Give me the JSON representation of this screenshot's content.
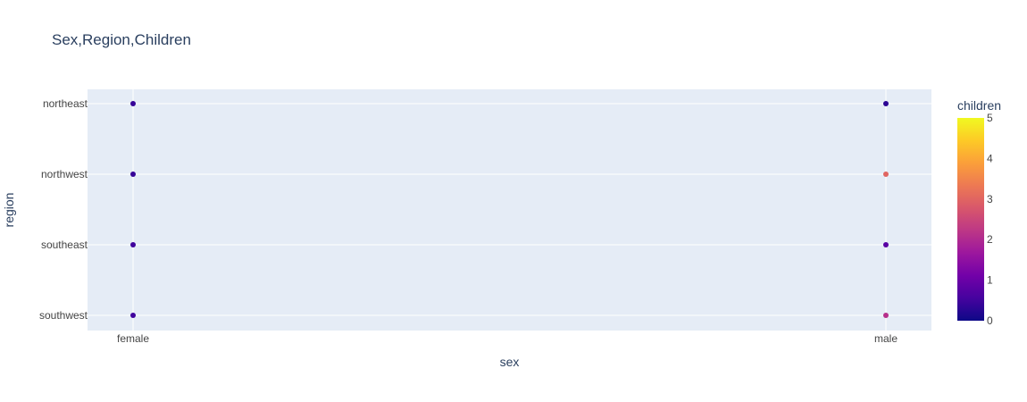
{
  "chart_data": {
    "type": "scatter",
    "title": "Sex,Region,Children",
    "xlabel": "sex",
    "ylabel": "region",
    "x_categories": [
      "female",
      "male"
    ],
    "y_categories": [
      "southwest",
      "southeast",
      "northwest",
      "northeast"
    ],
    "points": [
      {
        "x": "female",
        "y": "northeast",
        "children": 0.4
      },
      {
        "x": "male",
        "y": "northeast",
        "children": 0.3
      },
      {
        "x": "female",
        "y": "northwest",
        "children": 0.4
      },
      {
        "x": "male",
        "y": "northwest",
        "children": 3.0
      },
      {
        "x": "female",
        "y": "southeast",
        "children": 0.5
      },
      {
        "x": "male",
        "y": "southeast",
        "children": 0.8
      },
      {
        "x": "female",
        "y": "southwest",
        "children": 0.5
      },
      {
        "x": "male",
        "y": "southwest",
        "children": 2.1
      }
    ],
    "colorbar": {
      "title": "children",
      "min": 0,
      "max": 5,
      "ticks": [
        0,
        1,
        2,
        3,
        4,
        5
      ]
    },
    "grid": true,
    "colors": {
      "plot_bg": "#e5ecf6",
      "grid": "#ffffff",
      "text": "#2a3f5f",
      "tick_text": "#444444"
    },
    "colorscale": [
      "#0d0887",
      "#46039f",
      "#7201a8",
      "#9c179e",
      "#bd3786",
      "#d8576b",
      "#ed7953",
      "#fb9f3a",
      "#fdca26",
      "#f0f921"
    ]
  }
}
